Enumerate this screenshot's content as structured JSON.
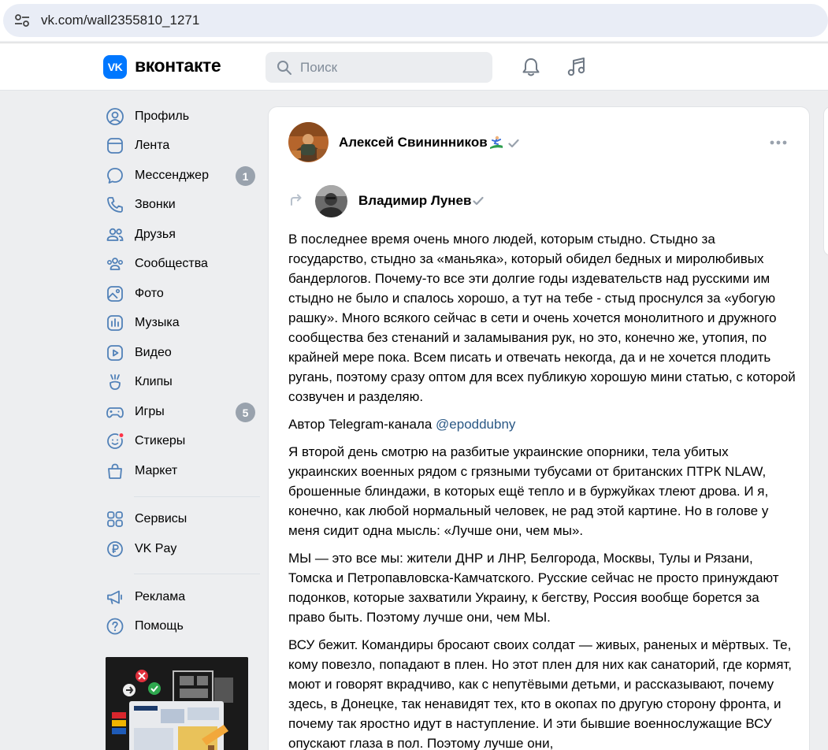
{
  "browser": {
    "url": "vk.com/wall2355810_1271"
  },
  "header": {
    "brand": "вконтакте",
    "logo_text": "VK",
    "search_placeholder": "Поиск"
  },
  "sidebar": {
    "items": [
      {
        "label": "Профиль",
        "icon": "profile-icon"
      },
      {
        "label": "Лента",
        "icon": "feed-icon"
      },
      {
        "label": "Мессенджер",
        "icon": "messenger-icon",
        "badge": "1"
      },
      {
        "label": "Звонки",
        "icon": "phone-icon"
      },
      {
        "label": "Друзья",
        "icon": "friends-icon"
      },
      {
        "label": "Сообщества",
        "icon": "communities-icon"
      },
      {
        "label": "Фото",
        "icon": "photo-icon"
      },
      {
        "label": "Музыка",
        "icon": "music-icon"
      },
      {
        "label": "Видео",
        "icon": "video-icon"
      },
      {
        "label": "Клипы",
        "icon": "clips-icon"
      },
      {
        "label": "Игры",
        "icon": "games-icon",
        "badge": "5"
      },
      {
        "label": "Стикеры",
        "icon": "stickers-icon"
      },
      {
        "label": "Маркет",
        "icon": "market-icon"
      }
    ],
    "items2": [
      {
        "label": "Сервисы",
        "icon": "services-icon"
      },
      {
        "label": "VK Pay",
        "icon": "vkpay-icon"
      }
    ],
    "items3": [
      {
        "label": "Реклама",
        "icon": "ads-icon"
      },
      {
        "label": "Помощь",
        "icon": "help-icon"
      }
    ]
  },
  "post": {
    "author": "Алексей Свининников",
    "repost_author": "Владимир Лунев",
    "paragraphs": [
      "В последнее время очень много людей, которым стыдно. Стыдно за государство, стыдно за «маньяка», который обидел бедных и миролюбивых бандерлогов. Почему-то все эти долгие годы издевательств над русскими им стыдно не было и спалось хорошо, а тут на тебе - стыд проснулся за «убогую рашку». Много всякого сейчас в сети и очень хочется монолитного и дружного сообщества без стенаний и заламывания рук, но это, конечно же, утопия, по крайней мере пока. Всем писать и отвечать некогда, да и не хочется плодить ругань, поэтому сразу оптом для всех публикую хорошую мини статью, с которой созвучен и разделяю.",
      "Я второй день смотрю на разбитые украинские опорники, тела убитых украинских военных рядом с грязными тубусами от британских ПТРК NLAW, брошенные блиндажи, в которых ещё тепло и в буржуйках тлеют дрова. И я, конечно, как любой нормальный человек, не рад этой картине. Но в голове у меня сидит одна мысль: «Лучше они, чем мы».",
      "МЫ — это все мы: жители ДНР и ЛНР, Белгорода, Москвы, Тулы и Рязани, Томска и Петропавловска-Камчатского. Русские сейчас не просто принуждают подонков, которые захватили Украину, к бегству, Россия вообще борется за право быть. Поэтому лучше они, чем МЫ.",
      "ВСУ бежит. Командиры бросают своих солдат — живых, раненых и мёртвых. Те, кому повезло, попадают в плен. Но этот плен для них как санаторий, где кормят, моют и говорят вкрадчиво, как с непутёвыми детьми, и рассказывают, почему здесь, в Донецке, так ненавидят тех, кто в окопах по другую сторону фронта, и почему так яростно идут в наступление. И эти бывшие военнослужащие ВСУ опускают глаза в пол. Поэтому лучше они,"
    ],
    "author_line_prefix": "Автор Telegram-канала",
    "author_line_mention": "@epoddubny"
  }
}
